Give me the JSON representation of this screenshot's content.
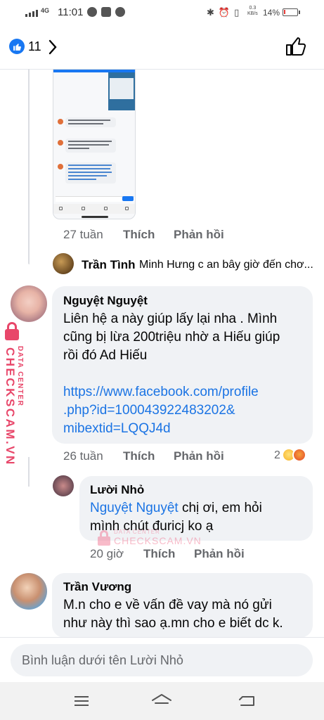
{
  "status_bar": {
    "network": "4G",
    "time": "11:01",
    "net_speed_value": "0.3",
    "net_speed_unit": "KB/s",
    "battery_text": "14%",
    "battery_level": 0.14
  },
  "reactions": {
    "count": "11"
  },
  "comments": [
    {
      "meta": {
        "time": "27 tuần",
        "like": "Thích",
        "reply": "Phản hồi"
      }
    },
    {
      "reply_preview": {
        "name": "Trần Tình",
        "snippet": "Minh Hưng c an bây giờ đến chơ..."
      }
    },
    {
      "name": "Nguyệt Nguyệt",
      "text_lines": [
        "Liên hệ a này giúp lấy lại nha . Mình",
        "cũng bị lừa 200triệu nhờ a Hiếu giúp",
        "rồi đó Ad Hiếu"
      ],
      "link_lines": [
        "https://www.facebook.com/profile",
        ".php?id=100043922483202&",
        "mibextid=LQQJ4d"
      ],
      "meta": {
        "time": "26 tuần",
        "like": "Thích",
        "reply": "Phản hồi",
        "reaction_count": "2"
      }
    },
    {
      "name": "Lười Nhỏ",
      "mention": "Nguyệt Nguyệt",
      "text_line1": " chị ơi,  em hỏi",
      "text_line2": "mình chút đuricj ko ạ",
      "meta": {
        "time": "20 giờ",
        "like": "Thích",
        "reply": "Phản hồi"
      }
    },
    {
      "name": "Trần Vương",
      "text_lines": [
        "M.n cho e về vấn đề vay mà nó gửi",
        "như này thì sao ạ.mn cho e biết dc k."
      ]
    }
  ],
  "watermark": {
    "small_text": "DATA CENTER",
    "brand": "CHECKSCAM.VN"
  },
  "composer": {
    "placeholder": "Bình luận dưới tên Lười Nhỏ"
  },
  "colors": {
    "facebook_blue": "#1877f2",
    "link": "#1b74e4",
    "watermark_pink": "#e8476a",
    "bubble": "#f0f2f5"
  }
}
